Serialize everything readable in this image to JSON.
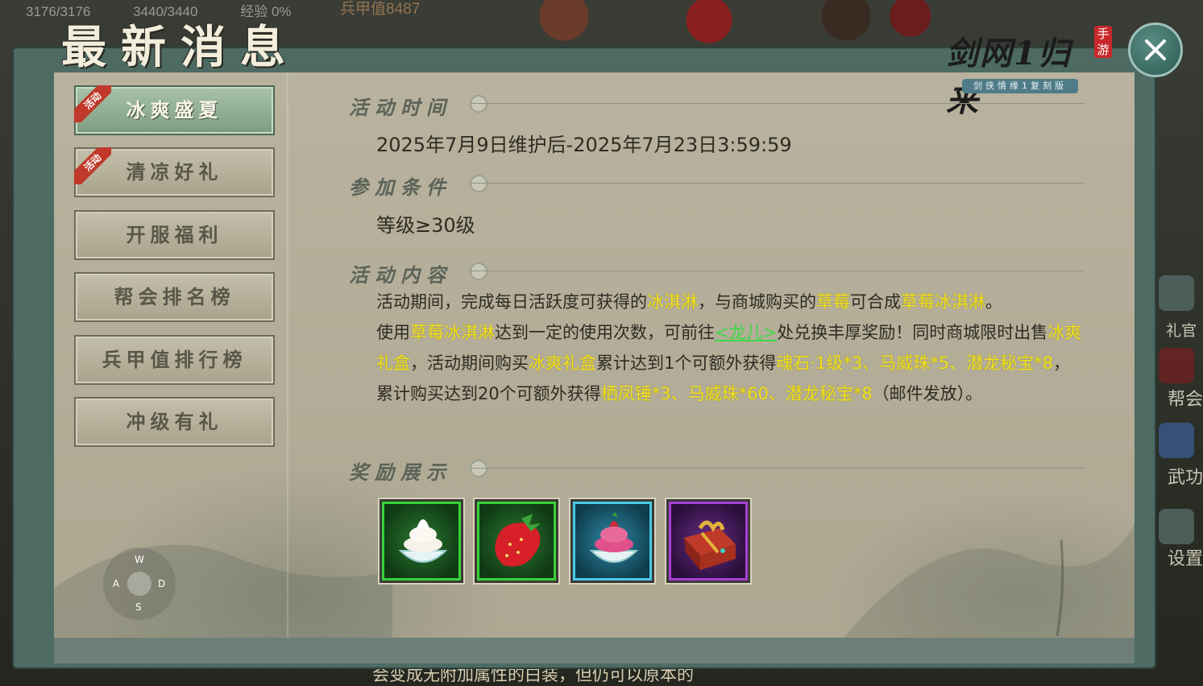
{
  "hud": {
    "hp": "3176/3176",
    "mp": "3440/3440",
    "exp": "经验 0%",
    "power": "兵甲值8487",
    "side_gift": "礼官",
    "side_guild": "帮会",
    "side_skill": "武功",
    "side_settings": "设置",
    "bottom_tip": "会变成无附加属性的白装，但仍可以原本的"
  },
  "window": {
    "title": "最新消息",
    "logo_text": "剑网1归来",
    "logo_seal": "手游",
    "logo_sub": "剑侠情缘1复刻版"
  },
  "tabs": [
    {
      "label": "冰爽盛夏",
      "badge": "活动",
      "active": true
    },
    {
      "label": "清凉好礼",
      "badge": "活动",
      "active": false
    },
    {
      "label": "开服福利",
      "badge": "",
      "active": false
    },
    {
      "label": "帮会排名榜",
      "badge": "",
      "active": false
    },
    {
      "label": "兵甲值排行榜",
      "badge": "",
      "active": false
    },
    {
      "label": "冲级有礼",
      "badge": "",
      "active": false
    }
  ],
  "sections": {
    "time_title": "活动时间",
    "time_value": "2025年7月9日维护后-2025年7月23日3:59:59",
    "cond_title": "参加条件",
    "cond_value": "等级≥30级",
    "content_title": "活动内容",
    "reward_title": "奖励展示"
  },
  "content": {
    "p1_a": "活动期间，完成每日活跃度可获得的",
    "p1_hl1": "冰淇淋",
    "p1_b": "，与商城购买的",
    "p1_hl2": "草莓",
    "p1_c": "可合成",
    "p1_hl3": "草莓冰淇淋",
    "p1_d": "。",
    "p2_a": "使用",
    "p2_hl1": "草莓冰淇淋",
    "p2_b": "达到一定的使用次数，可前往",
    "p2_npc": "<龙儿>",
    "p2_c": "处兑换丰厚奖励！同时商城限时出售",
    "p2_hl2": "冰爽礼盒",
    "p2_d": "，活动期间购买",
    "p2_hl3": "冰爽礼盒",
    "p2_e": "累计达到1个可额外获得",
    "p2_hl4": "魂石·1级*3、马威珠*5、潜龙秘宝*8",
    "p2_f": "，累计购买达到20个可额外获得",
    "p2_hl5": "栖凤锤*3、马威珠*60、潜龙秘宝*8",
    "p2_g": "（邮件发放）。"
  },
  "rewards": [
    {
      "icon": "ice-cream-icon",
      "rarity": "green"
    },
    {
      "icon": "strawberry-icon",
      "rarity": "green"
    },
    {
      "icon": "strawberry-ice-cream-icon",
      "rarity": "blue"
    },
    {
      "icon": "gift-box-icon",
      "rarity": "purple"
    }
  ],
  "joystick": {
    "up": "W",
    "left": "A",
    "right": "D",
    "down": "S"
  },
  "colors": {
    "highlight": "#f2e21c",
    "npc_link": "#3ed847",
    "active_tab": "#8fb093",
    "frame": "#4d6b63"
  }
}
